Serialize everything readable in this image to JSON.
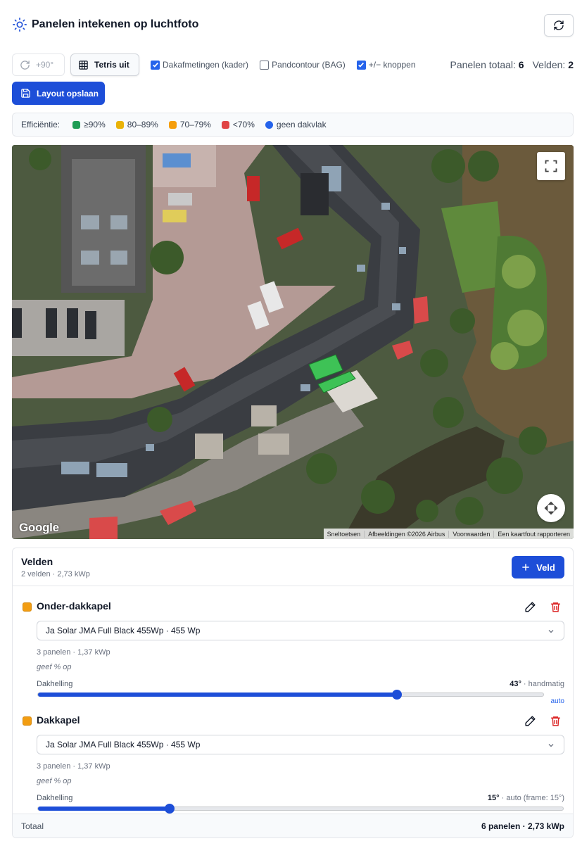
{
  "header": {
    "title": "Panelen intekenen op luchtfoto"
  },
  "toolbar": {
    "rotate_label": "+90°",
    "tetris_label": "Tetris uit",
    "checkboxes": [
      {
        "label": "Dakafmetingen (kader)",
        "checked": true
      },
      {
        "label": "Pandcontour (BAG)",
        "checked": false
      },
      {
        "label": "+/− knoppen",
        "checked": true
      }
    ],
    "panels_total_label": "Panelen totaal:",
    "panels_total_value": "6",
    "fields_label": "Velden:",
    "fields_value": "2",
    "save_label": "Layout opslaan"
  },
  "legend": {
    "label": "Efficiëntie:",
    "items": [
      {
        "label": "≥90%",
        "color": "#1f9d55"
      },
      {
        "label": "80–89%",
        "color": "#eab308"
      },
      {
        "label": "70–79%",
        "color": "#f59e0b"
      },
      {
        "label": "<70%",
        "color": "#e04444"
      },
      {
        "label": "geen dakvlak",
        "color": "#2563eb"
      }
    ]
  },
  "map": {
    "logo": "Google",
    "attribution": [
      "Sneltoetsen",
      "Afbeeldingen ©2026 Airbus",
      "Voorwaarden",
      "Een kaartfout rapporteren"
    ]
  },
  "velden": {
    "title": "Velden",
    "subtitle": "2 velden · 2,73 kWp",
    "add_label": "Veld",
    "fields": [
      {
        "name": "Onder-dakkapel",
        "color": "#f29d12",
        "panel": "Ja Solar JMA Full Black 455Wp · 455 Wp",
        "meta": "3 panelen · 1,37 kWp",
        "hint": "geef % op",
        "slope_label": "Dakhelling",
        "slope_value": "43°",
        "slope_suffix": " · handmatig",
        "slope_degrees": 43,
        "slope_fraction": 0.71,
        "auto_link": "auto"
      },
      {
        "name": "Dakkapel",
        "color": "#f29d12",
        "panel": "Ja Solar JMA Full Black 455Wp · 455 Wp",
        "meta": "3 panelen · 1,37 kWp",
        "hint": "geef % op",
        "slope_label": "Dakhelling",
        "slope_value": "15°",
        "slope_suffix": " · auto (frame: 15°)",
        "slope_degrees": 15,
        "slope_fraction": 0.25
      }
    ],
    "total_label": "Totaal",
    "total_value": "6 panelen · 2,73 kWp"
  }
}
